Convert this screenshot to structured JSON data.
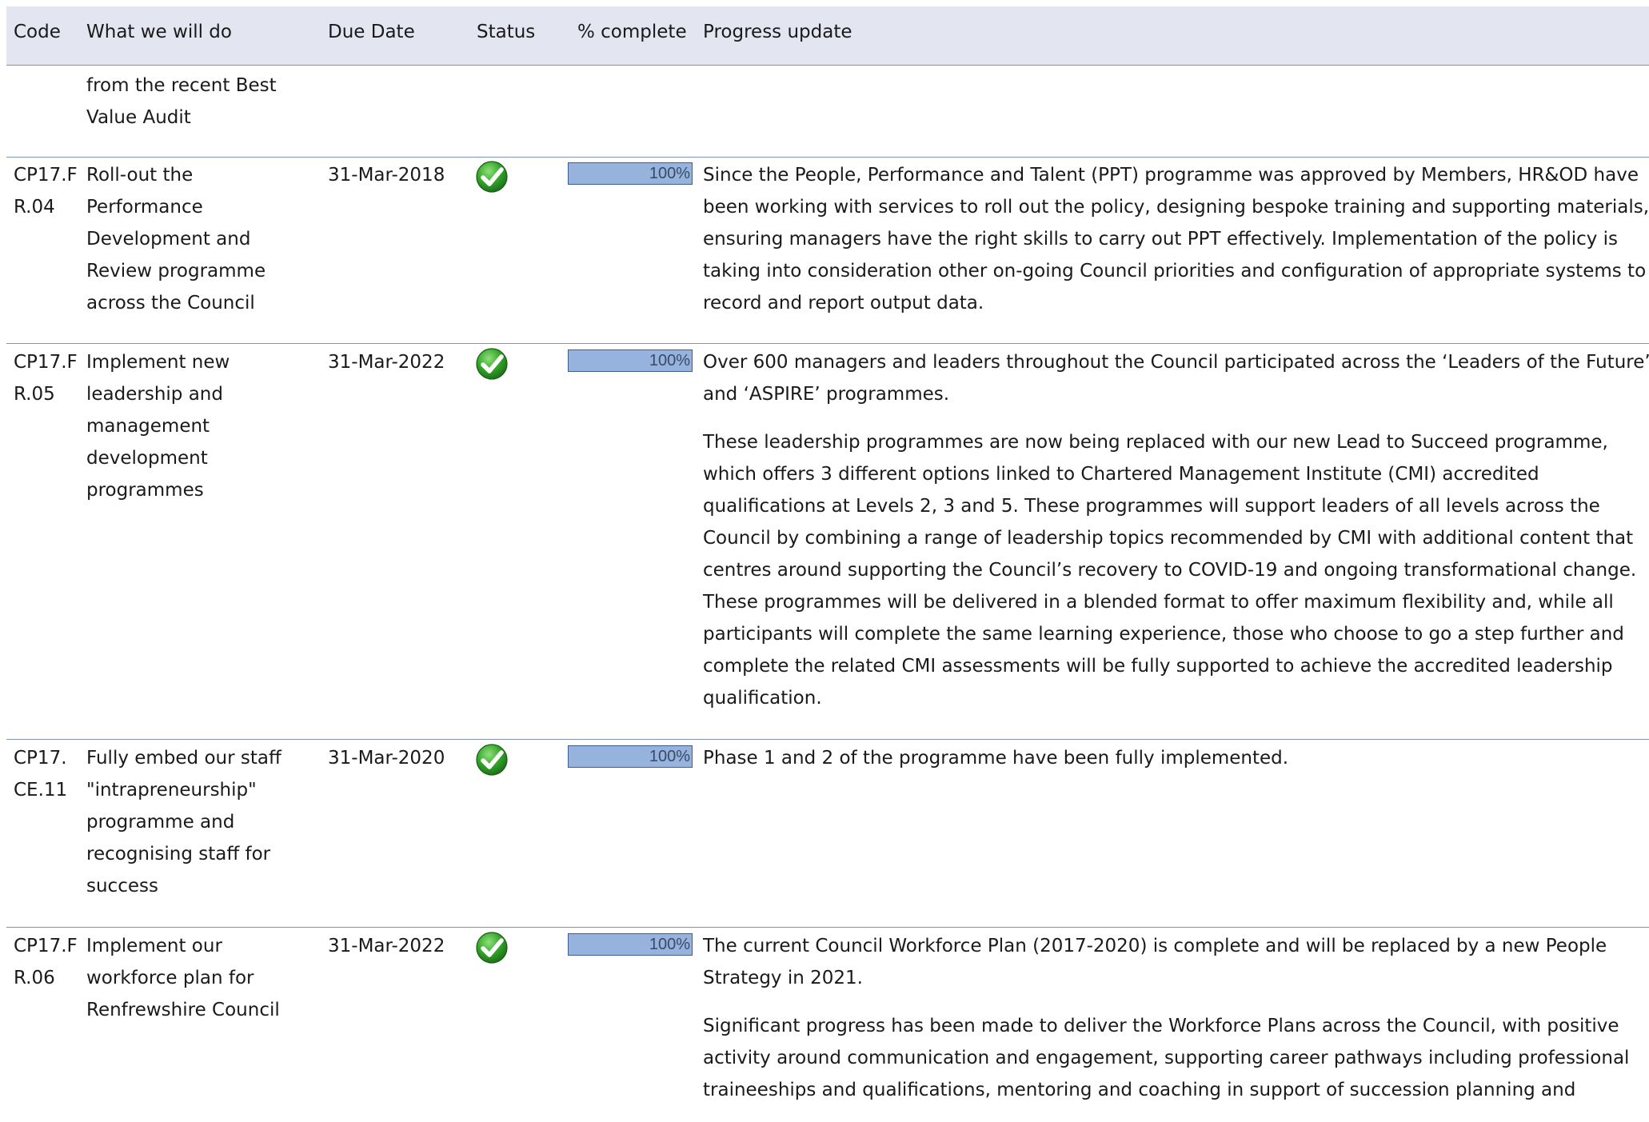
{
  "columns": {
    "code": "Code",
    "what": "What we will do",
    "due": "Due Date",
    "status": "Status",
    "pct": "% complete",
    "update": "Progress update"
  },
  "continued_row": {
    "what_lines": [
      "from the recent Best",
      "Value Audit"
    ]
  },
  "rows": [
    {
      "code_lines": [
        "CP17.F",
        "R.04"
      ],
      "what_lines": [
        "Roll-out the",
        "Performance",
        "Development and",
        "Review programme",
        "across the Council"
      ],
      "due": "31-Mar-2018",
      "status_icon": "green-check-icon",
      "percent": 100,
      "percent_label": "100%",
      "update_paragraphs": [
        "Since the People, Performance and Talent (PPT) programme was approved by Members, HR&OD have been working with services to roll out the policy, designing bespoke training and supporting materials, ensuring managers have the right skills to carry out PPT effectively. Implementation of the policy is taking into consideration other on-going Council priorities and configuration of appropriate systems to record and report output data."
      ]
    },
    {
      "code_lines": [
        "CP17.F",
        "R.05"
      ],
      "what_lines": [
        "Implement new",
        "leadership and",
        "management",
        "development",
        "programmes"
      ],
      "due": "31-Mar-2022",
      "status_icon": "green-check-icon",
      "percent": 100,
      "percent_label": "100%",
      "update_paragraphs": [
        "Over 600 managers and leaders throughout the Council participated across the ‘Leaders of the Future’ and ‘ASPIRE’ programmes.",
        "These leadership programmes are now being replaced with our new Lead to Succeed programme, which offers 3 different options linked to Chartered Management Institute (CMI) accredited qualifications at Levels 2, 3 and 5.  These programmes will support leaders of all levels across the Council by combining a range of leadership topics recommended by CMI with additional content that centres around supporting the Council’s recovery to COVID-19 and ongoing transformational change. These programmes will be delivered in a blended format to offer maximum flexibility and, while all participants will complete the same learning experience, those who choose to go a step further and complete the related CMI assessments will be fully supported to achieve the accredited leadership qualification."
      ]
    },
    {
      "code_lines": [
        "CP17.",
        "CE.11"
      ],
      "what_lines": [
        "Fully embed our staff",
        "\"intrapreneurship\"",
        "programme and",
        "recognising staff for",
        "success"
      ],
      "due": "31-Mar-2020",
      "status_icon": "green-check-icon",
      "percent": 100,
      "percent_label": "100%",
      "update_paragraphs": [
        "Phase 1 and 2 of the programme have been fully implemented."
      ]
    },
    {
      "code_lines": [
        "CP17.F",
        "R.06"
      ],
      "what_lines": [
        "Implement our",
        "workforce plan for",
        "Renfrewshire Council"
      ],
      "due": "31-Mar-2022",
      "status_icon": "green-check-icon",
      "percent": 100,
      "percent_label": "100%",
      "update_paragraphs": [
        "The current Council Workforce Plan (2017-2020) is complete and will be replaced by a new People Strategy in 2021.",
        "Significant progress has been made to deliver the Workforce Plans across the Council, with positive activity around communication and engagement, supporting career pathways including professional traineeships and qualifications, mentoring and coaching in support of succession planning and"
      ]
    }
  ]
}
